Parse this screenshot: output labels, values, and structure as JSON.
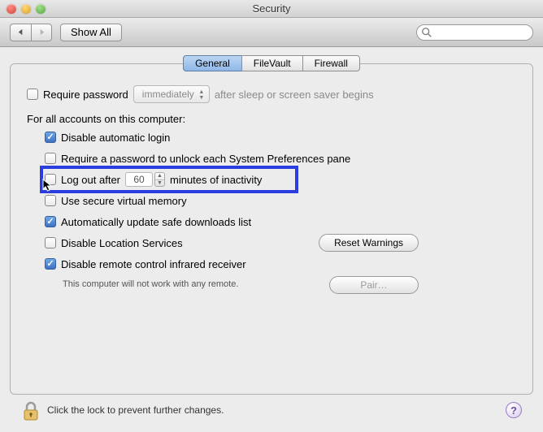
{
  "window": {
    "title": "Security"
  },
  "toolbar": {
    "showall_label": "Show All",
    "search_placeholder": ""
  },
  "tabs": [
    {
      "label": "General",
      "active": true
    },
    {
      "label": "FileVault",
      "active": false
    },
    {
      "label": "Firewall",
      "active": false
    }
  ],
  "panel": {
    "require_password": {
      "checked": false,
      "label": "Require password",
      "timing_selected": "immediately",
      "after_label": "after sleep or screen saver begins"
    },
    "accounts_label": "For all accounts on this computer:",
    "disable_auto_login": {
      "checked": true,
      "label": "Disable automatic login"
    },
    "require_unlock_pane": {
      "checked": false,
      "label": "Require a password to unlock each System Preferences pane"
    },
    "logout": {
      "checked": false,
      "label_before": "Log out after",
      "minutes": "60",
      "label_after": "minutes of inactivity"
    },
    "secure_vm": {
      "checked": false,
      "label": "Use secure virtual memory"
    },
    "auto_update_safe": {
      "checked": true,
      "label": "Automatically update safe downloads list"
    },
    "disable_location": {
      "checked": false,
      "label": "Disable Location Services"
    },
    "reset_warnings_label": "Reset Warnings",
    "disable_ir": {
      "checked": true,
      "label": "Disable remote control infrared receiver"
    },
    "ir_note": "This computer will not work with any remote.",
    "pair_label": "Pair…"
  },
  "footer": {
    "lock_text": "Click the lock to prevent further changes."
  }
}
